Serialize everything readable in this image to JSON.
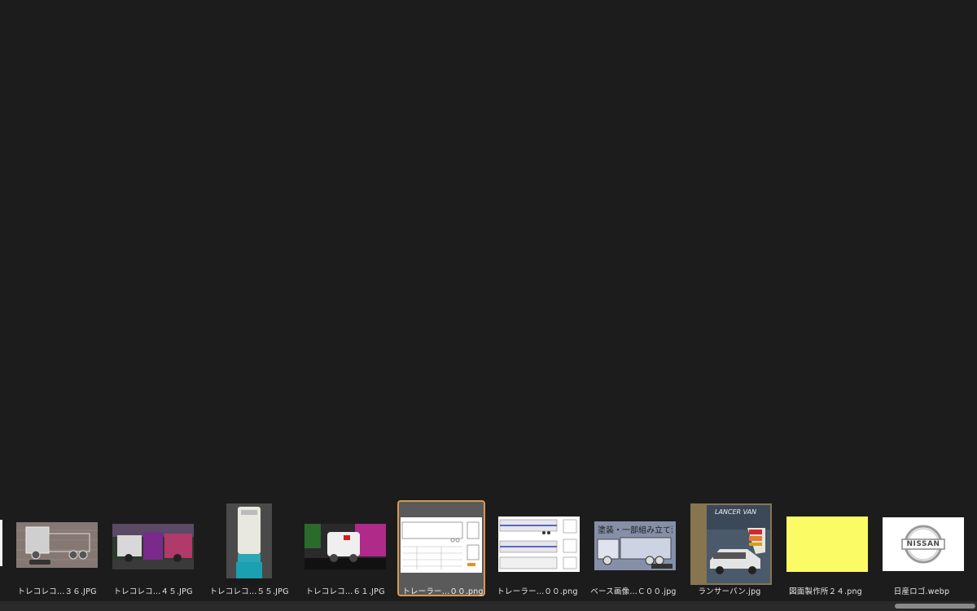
{
  "viewer": {
    "background_color": "#1c1c1c"
  },
  "filmstrip": {
    "selected_index": 4,
    "selection_color": "#d99a4e",
    "items": [
      {
        "label": "トレコレコ…３６.JPG"
      },
      {
        "label": "トレコレコ…４５.JPG"
      },
      {
        "label": "トレコレコ…５５.JPG"
      },
      {
        "label": "トレコレコ…６１.JPG"
      },
      {
        "label": "トレーラー…００.png"
      },
      {
        "label": "トレーラー…００.png"
      },
      {
        "label": "ベース画像…Ｃ００.jpg",
        "thumb_text": "塗装・一部組み立て済"
      },
      {
        "label": "ランサーバン.jpg",
        "thumb_text": "LANCER VAN"
      },
      {
        "label": "図面製作所２４.png"
      },
      {
        "label": "日産ロゴ.webp",
        "thumb_text": "NISSAN"
      }
    ]
  }
}
